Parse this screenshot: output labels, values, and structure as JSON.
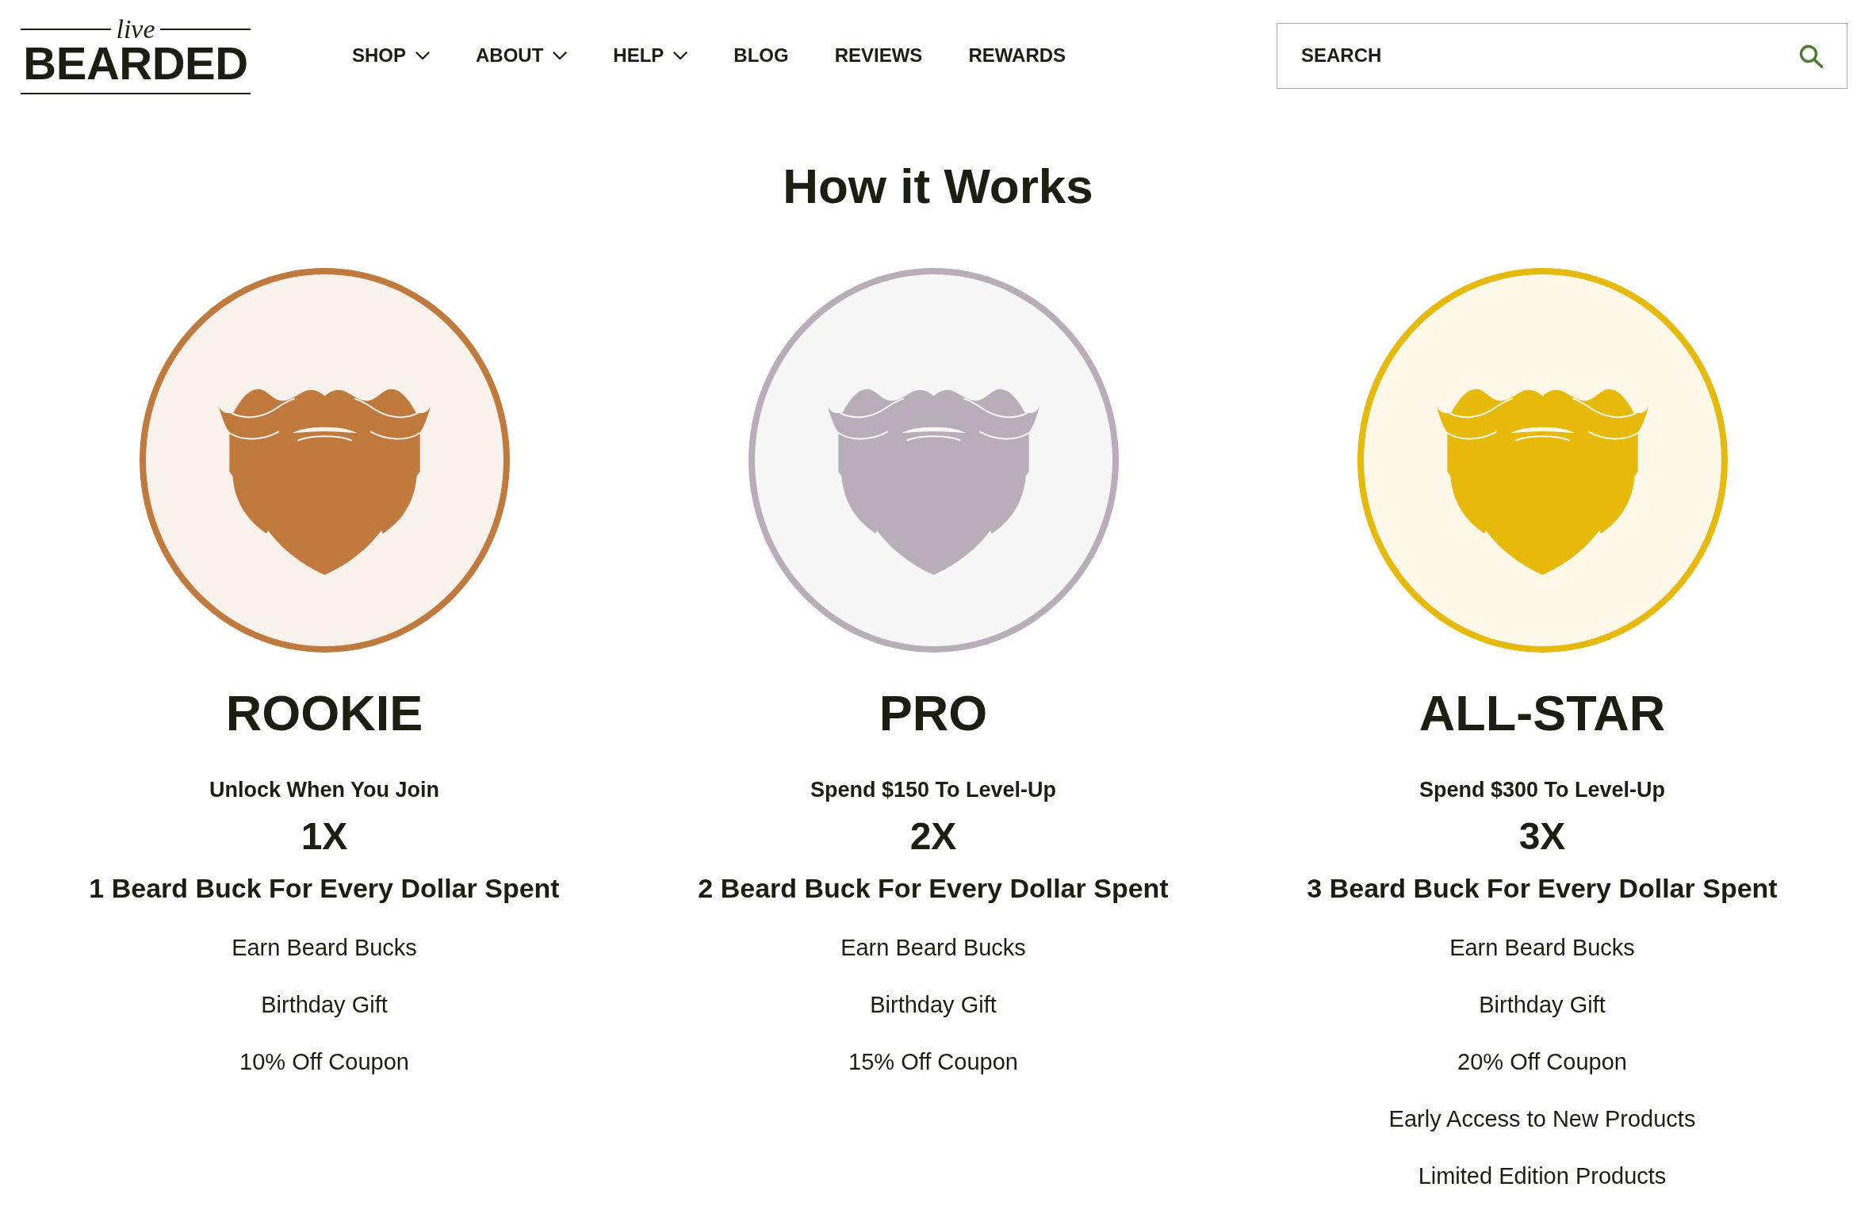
{
  "header": {
    "logo": {
      "script": "live",
      "wordmark": "BEARDED"
    },
    "nav": [
      {
        "label": "SHOP",
        "dropdown": true
      },
      {
        "label": "ABOUT",
        "dropdown": true
      },
      {
        "label": "HELP",
        "dropdown": true
      },
      {
        "label": "BLOG",
        "dropdown": false
      },
      {
        "label": "REVIEWS",
        "dropdown": false
      },
      {
        "label": "REWARDS",
        "dropdown": false
      }
    ],
    "search": {
      "placeholder": "SEARCH"
    }
  },
  "how_it_works": {
    "title": "How it Works",
    "tiers": [
      {
        "name": "ROOKIE",
        "color": "#c17a3e",
        "requirement": "Unlock When You Join",
        "multiplier": "1X",
        "earn_rate": "1 Beard Buck For Every Dollar Spent",
        "perks": [
          "Earn Beard Bucks",
          "Birthday Gift",
          "10% Off Coupon"
        ]
      },
      {
        "name": "PRO",
        "color": "#b9adb9",
        "requirement": "Spend $150 To Level-Up",
        "multiplier": "2X",
        "earn_rate": "2 Beard Buck For Every Dollar Spent",
        "perks": [
          "Earn Beard Bucks",
          "Birthday Gift",
          "15% Off Coupon"
        ]
      },
      {
        "name": "ALL-STAR",
        "color": "#e6b90b",
        "requirement": "Spend $300 To Level-Up",
        "multiplier": "3X",
        "earn_rate": "3 Beard Buck For Every Dollar Spent",
        "perks": [
          "Earn Beard Bucks",
          "Birthday Gift",
          "20% Off Coupon",
          "Early Access to New Products",
          "Limited Edition Products"
        ]
      }
    ]
  }
}
